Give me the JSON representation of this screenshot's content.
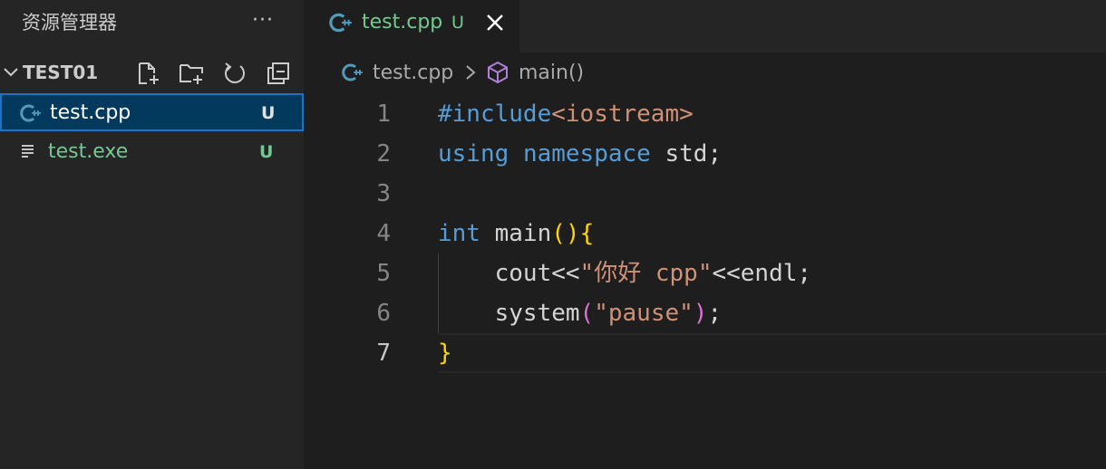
{
  "sidebar": {
    "title": "资源管理器",
    "more": "···",
    "folder": {
      "name": "TEST01"
    },
    "toolbar": [
      "new-file-icon",
      "new-folder-icon",
      "refresh-icon",
      "collapse-all-icon"
    ],
    "files": [
      {
        "name": "test.cpp",
        "status": "U",
        "icon": "cpp-icon",
        "selected": true
      },
      {
        "name": "test.exe",
        "status": "U",
        "icon": "lines-file-icon",
        "selected": false
      }
    ]
  },
  "tab": {
    "label": "test.cpp",
    "status": "U"
  },
  "breadcrumb": {
    "file": "test.cpp",
    "symbol": "main()"
  },
  "editor": {
    "line_numbers": [
      "1",
      "2",
      "3",
      "4",
      "5",
      "6",
      "7"
    ],
    "active_line": "7",
    "lines": [
      [
        {
          "t": "#include",
          "c": "inc"
        },
        {
          "t": "<iostream>",
          "c": "incf"
        }
      ],
      [
        {
          "t": "using",
          "c": "kw"
        },
        {
          "t": " ",
          "c": "id"
        },
        {
          "t": "namespace",
          "c": "kw"
        },
        {
          "t": " std;",
          "c": "id"
        }
      ],
      [],
      [
        {
          "t": "int",
          "c": "kw"
        },
        {
          "t": " main",
          "c": "id"
        },
        {
          "t": "()",
          "c": "br1"
        },
        {
          "t": "{",
          "c": "br1"
        }
      ],
      [
        {
          "t": "    cout<<",
          "c": "id"
        },
        {
          "t": "\"你好 cpp\"",
          "c": "str"
        },
        {
          "t": "<<endl;",
          "c": "id"
        }
      ],
      [
        {
          "t": "    system",
          "c": "id"
        },
        {
          "t": "(",
          "c": "br2"
        },
        {
          "t": "\"pause\"",
          "c": "str"
        },
        {
          "t": ")",
          "c": "br2"
        },
        {
          "t": ";",
          "c": "id"
        }
      ],
      [
        {
          "t": "}",
          "c": "br1"
        }
      ]
    ]
  },
  "colors": {
    "sidebar_bg": "#252526",
    "editor_bg": "#1e1e1e",
    "untracked_green": "#73c991",
    "keyword_blue": "#569cd6",
    "string_orange": "#ce9178",
    "selection_border": "#1a73c8",
    "annotation_red": "#e8222a"
  }
}
